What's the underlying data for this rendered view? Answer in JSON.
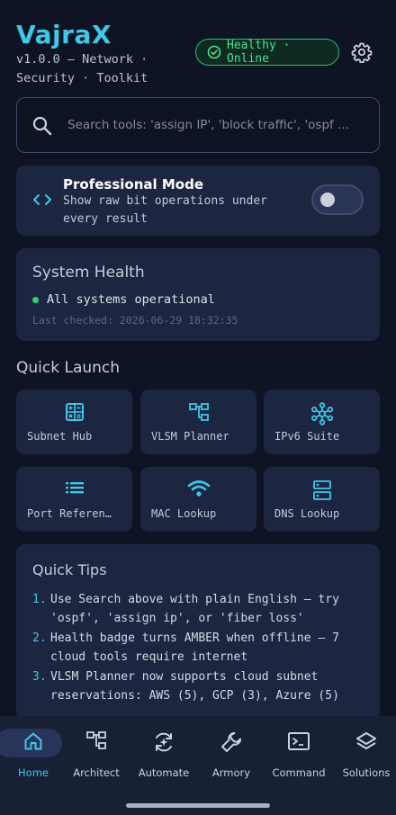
{
  "header": {
    "title": "VajraX",
    "subtitle": "v1.0.0 — Network · Security · Toolkit",
    "health_badge": "Healthy · Online",
    "settings_icon": "gear-icon"
  },
  "search": {
    "placeholder": "Search tools: 'assign IP', 'block traffic', 'ospf ..."
  },
  "pro_mode": {
    "title": "Professional Mode",
    "description": "Show raw bit operations under every result",
    "enabled": false
  },
  "system_health": {
    "title": "System Health",
    "status": "All systems operational",
    "last_checked": "Last checked: 2026-06-29 18:32:35"
  },
  "quick_launch": {
    "title": "Quick Launch",
    "tiles": [
      {
        "label": "Subnet Hub",
        "icon": "calculator-icon"
      },
      {
        "label": "VLSM Planner",
        "icon": "hierarchy-icon"
      },
      {
        "label": "IPv6 Suite",
        "icon": "hub-icon"
      },
      {
        "label": "Port Referen…",
        "icon": "list-icon"
      },
      {
        "label": "MAC Lookup",
        "icon": "wifi-icon"
      },
      {
        "label": "DNS Lookup",
        "icon": "dns-icon"
      }
    ]
  },
  "quick_tips": {
    "title": "Quick Tips",
    "tips": [
      {
        "num": "1.",
        "text": "Use Search above with plain English — try 'ospf', 'assign ip', or 'fiber loss'"
      },
      {
        "num": "2.",
        "text": "Health badge turns AMBER when offline — 7 cloud tools require internet"
      },
      {
        "num": "3.",
        "text": "VLSM Planner now supports cloud subnet reservations: AWS (5), GCP (3), Azure (5)"
      }
    ]
  },
  "bottom_nav": {
    "items": [
      {
        "label": "Home",
        "icon": "home-icon",
        "active": true
      },
      {
        "label": "Architect",
        "icon": "hierarchy-icon"
      },
      {
        "label": "Automate",
        "icon": "automate-icon"
      },
      {
        "label": "Armory",
        "icon": "wrench-icon"
      },
      {
        "label": "Command",
        "icon": "terminal-icon"
      },
      {
        "label": "Solutions",
        "icon": "layers-icon"
      }
    ]
  },
  "colors": {
    "accent": "#3fc8ea",
    "background": "#0e1424",
    "card": "#1d2640",
    "healthy": "#4fe28a"
  }
}
